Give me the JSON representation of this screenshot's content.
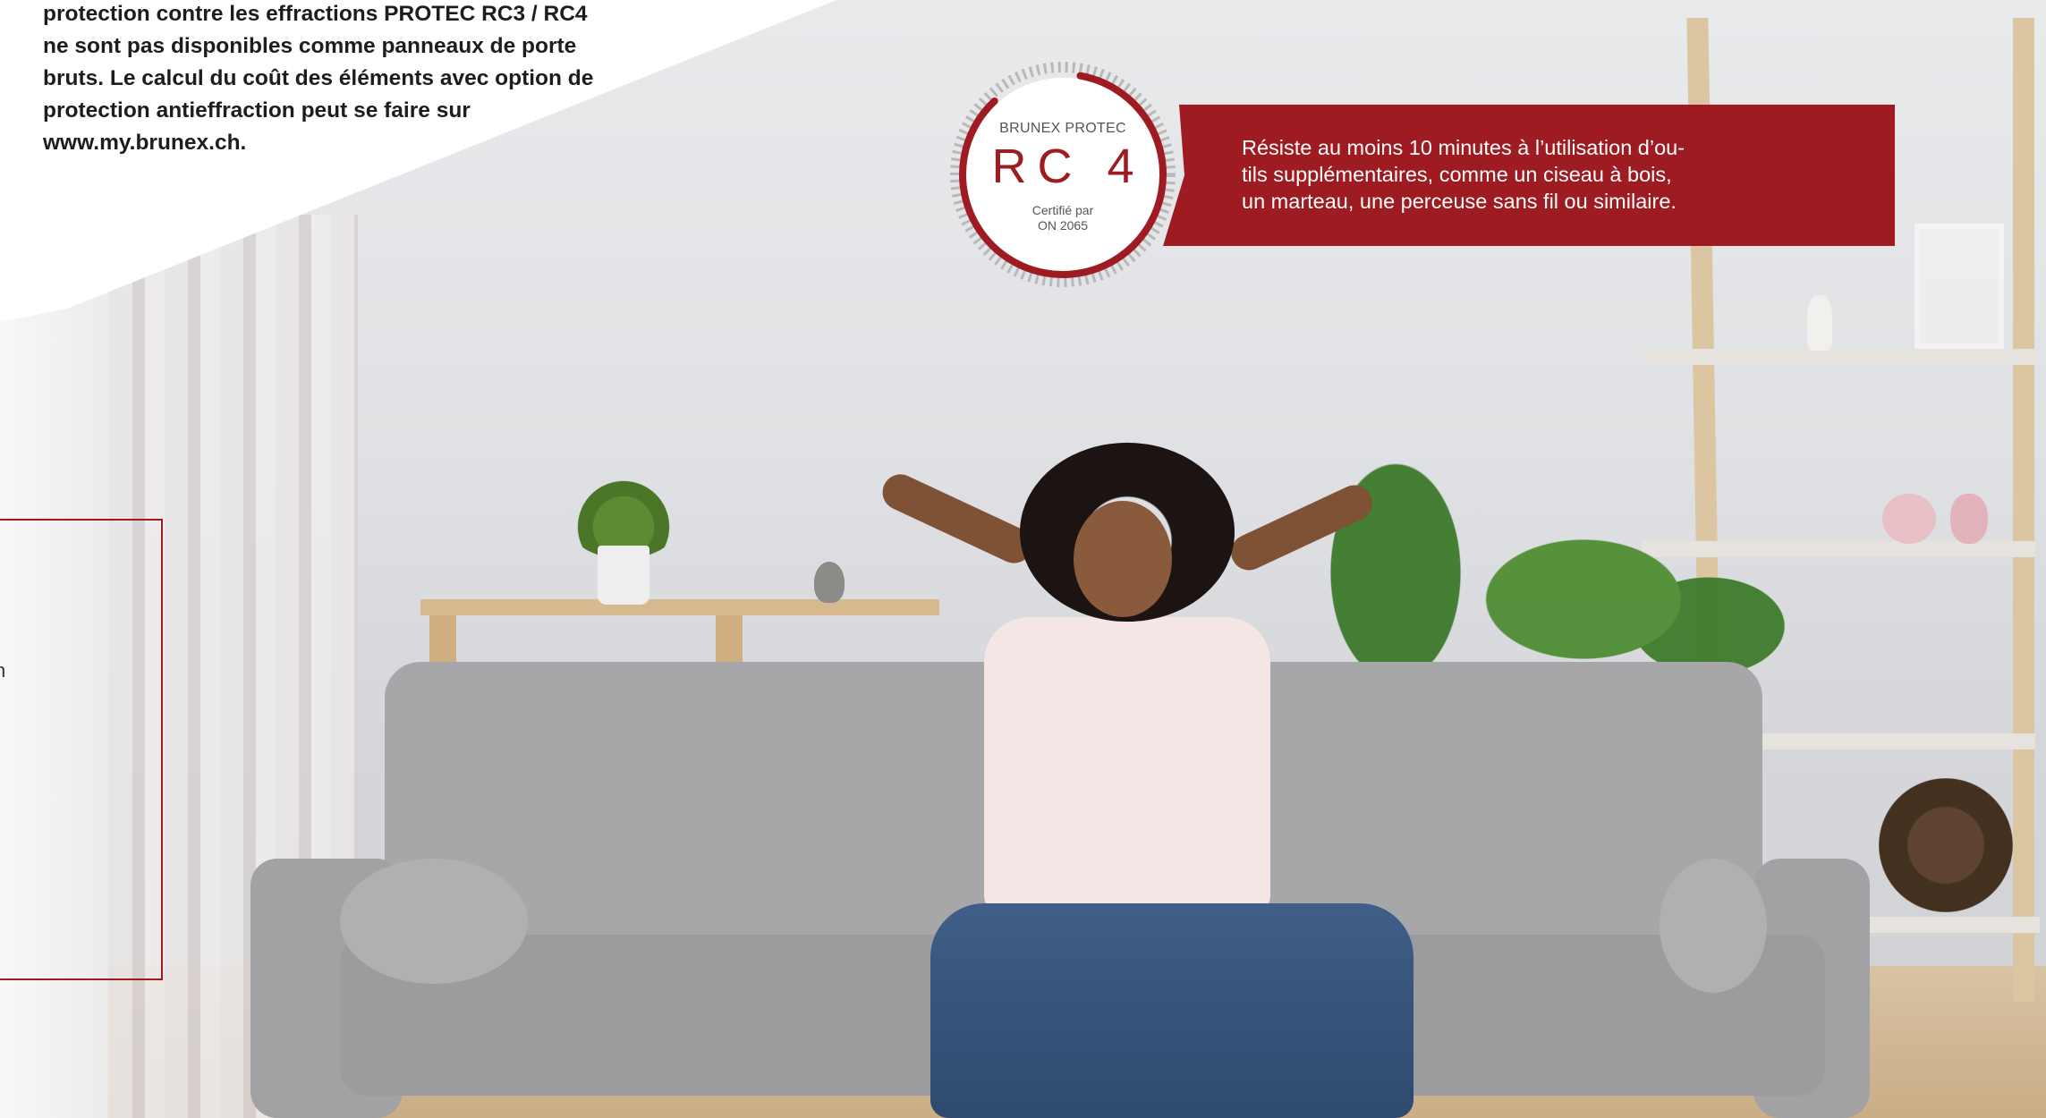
{
  "intro": {
    "text": "protection contre les effractions PROTEC RC3 / RC4\nne sont pas disponibles comme panneaux de porte\nbruts. Le calcul du coût des éléments avec option de\nprotection antieffraction peut se faire sur\nwww.my.brunex.ch."
  },
  "info_box": {
    "fragment_1": "n",
    "fragment_2": ":"
  },
  "badge": {
    "brand": "BRUNEX PROTEC",
    "level": "RC 4",
    "cert_line1": "Certifié par",
    "cert_line2": "ON 2065"
  },
  "banner": {
    "text": "Résiste au moins 10 minutes à l’utilisation d’ou-\ntils supplémentaires, comme un ciseau à bois,\nun marteau, une perceuse sans fil ou similaire."
  },
  "colors": {
    "accent_red": "#9e1b22",
    "text_dark": "#1d1d1b"
  }
}
